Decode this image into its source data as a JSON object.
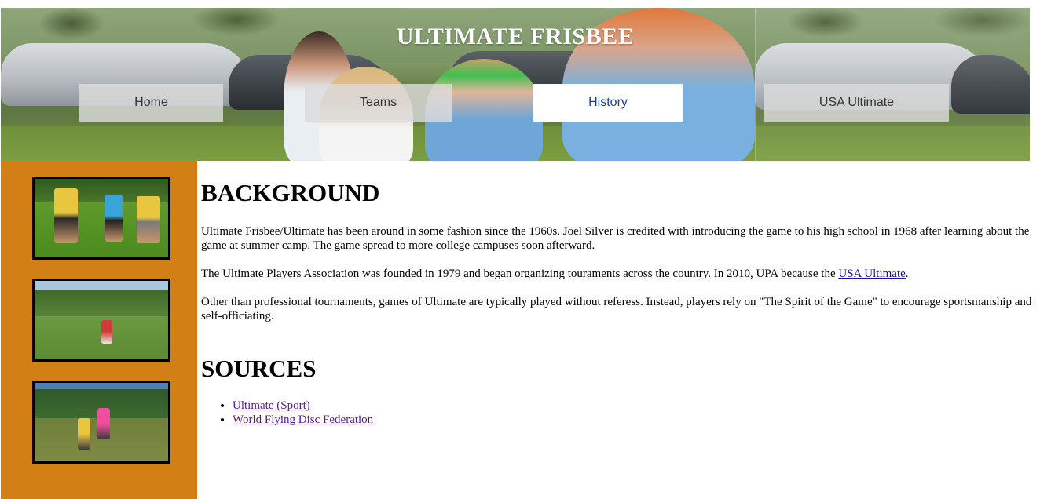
{
  "header": {
    "title": "ULTIMATE FRISBEE",
    "nav": [
      {
        "label": "Home",
        "active": false
      },
      {
        "label": "Teams",
        "active": false
      },
      {
        "label": "History",
        "active": true
      },
      {
        "label": "USA Ultimate",
        "active": false
      }
    ]
  },
  "sidebar": {
    "background_color": "#d27f15",
    "thumbnails": [
      {
        "alt": "ultimate-players-photo-1"
      },
      {
        "alt": "ultimate-players-photo-2"
      },
      {
        "alt": "ultimate-players-photo-3"
      }
    ]
  },
  "main": {
    "background": {
      "heading": "BACKGROUND",
      "paragraph_1": "Ultimate Frisbee/Ultimate has been around in some fashion since the 1960s. Joel Silver is credited with introducing the game to his high school in 1968 after learning about the game at summer camp. The game spread to more college campuses soon afterward.",
      "paragraph_2_before_link": "The Ultimate Players Association was founded in 1979 and began organizing touraments across the country. In 2010, UPA because the ",
      "paragraph_2_link": "USA Ultimate",
      "paragraph_2_after_link": ".",
      "paragraph_3": "Other than professional tournaments, games of Ultimate are typically played without referess. Instead, players rely on \"The Spirit of the Game\" to encourage sportsmanship and self-officiating."
    },
    "sources": {
      "heading": "SOURCES",
      "links": [
        {
          "label": "Ultimate (Sport)"
        },
        {
          "label": "World Flying Disc Federation"
        }
      ]
    }
  },
  "colors": {
    "link": "#1a0dab",
    "visited_link": "#551a8b",
    "active_nav_text": "#1f3f8f"
  }
}
